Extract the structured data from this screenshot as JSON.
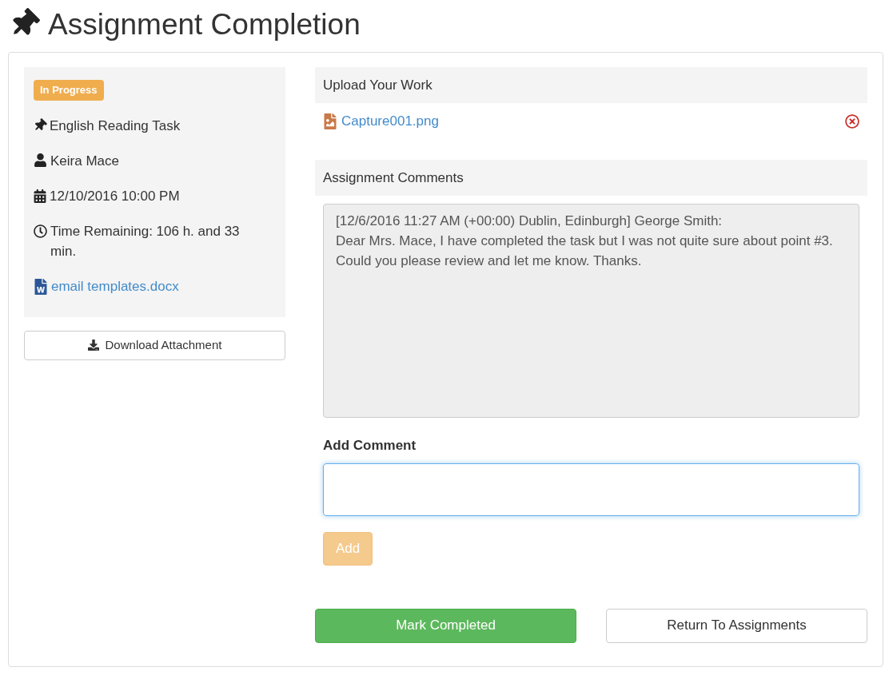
{
  "title": "Assignment Completion",
  "details": {
    "status": "In Progress",
    "task": "English Reading Task",
    "teacher": "Keira Mace",
    "due": "12/10/2016 10:00 PM",
    "remaining": "Time Remaining: 106 h. and 33 min.",
    "attachment": "email templates.docx"
  },
  "download_button": "Download Attachment",
  "upload": {
    "heading": "Upload Your Work",
    "files": [
      {
        "name": "Capture001.png"
      }
    ]
  },
  "comments": {
    "heading": "Assignment Comments",
    "entries": [
      {
        "header": "[12/6/2016 11:27 AM (+00:00) Dublin, Edinburgh] George Smith:",
        "body": "Dear Mrs. Mace, I have completed the task but I was not quite sure about point #3. Could you please review and let me know. Thanks."
      }
    ]
  },
  "add_comment": {
    "label": "Add Comment",
    "button": "Add",
    "disabled": true
  },
  "actions": [
    {
      "label": "Mark Completed",
      "kind": "primary"
    },
    {
      "label": "Return To Assignments",
      "kind": "default"
    }
  ]
}
